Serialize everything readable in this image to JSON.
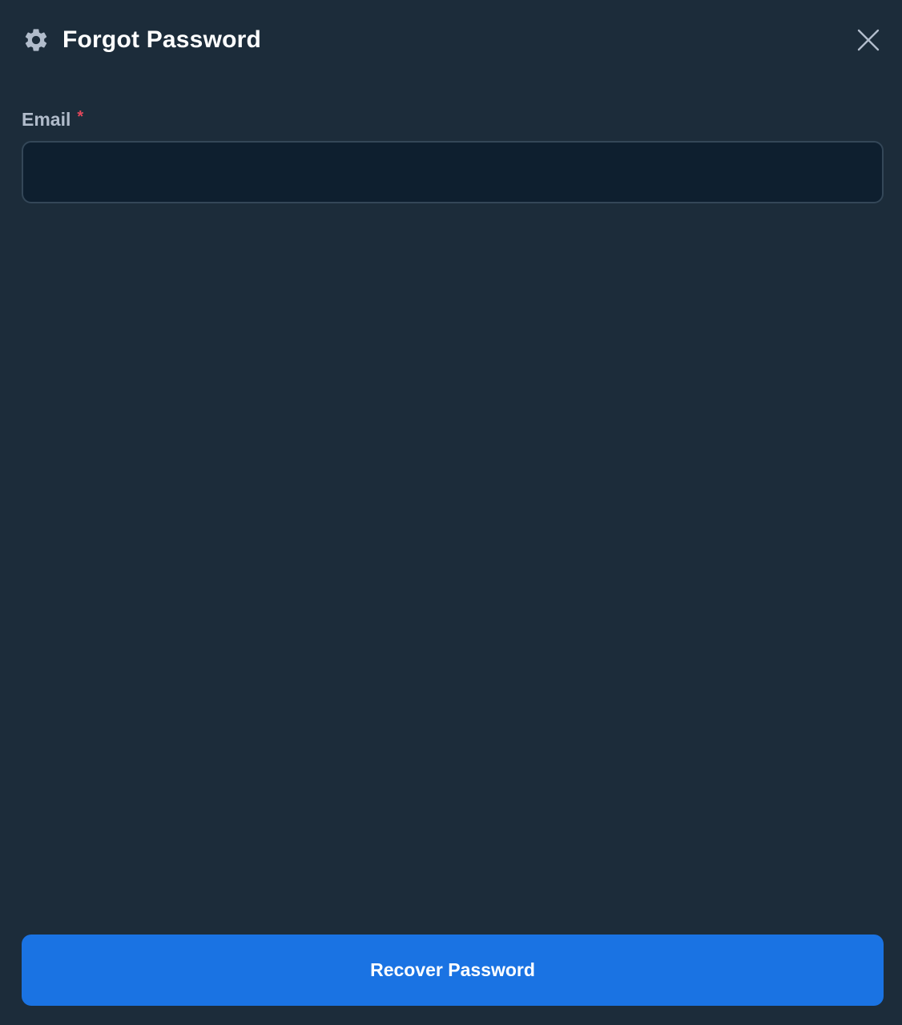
{
  "dialog": {
    "title": "Forgot Password",
    "title_icon": "gear-icon",
    "close_icon": "close-icon"
  },
  "form": {
    "email": {
      "label": "Email",
      "required_mark": "*",
      "value": "",
      "placeholder": ""
    },
    "submit_label": "Recover Password"
  },
  "colors": {
    "background": "#1c2c3a",
    "input_background": "#0e1f2f",
    "input_border": "#344758",
    "primary_button": "#1a73e3",
    "required": "#e2475b",
    "label": "#b1bccb"
  }
}
